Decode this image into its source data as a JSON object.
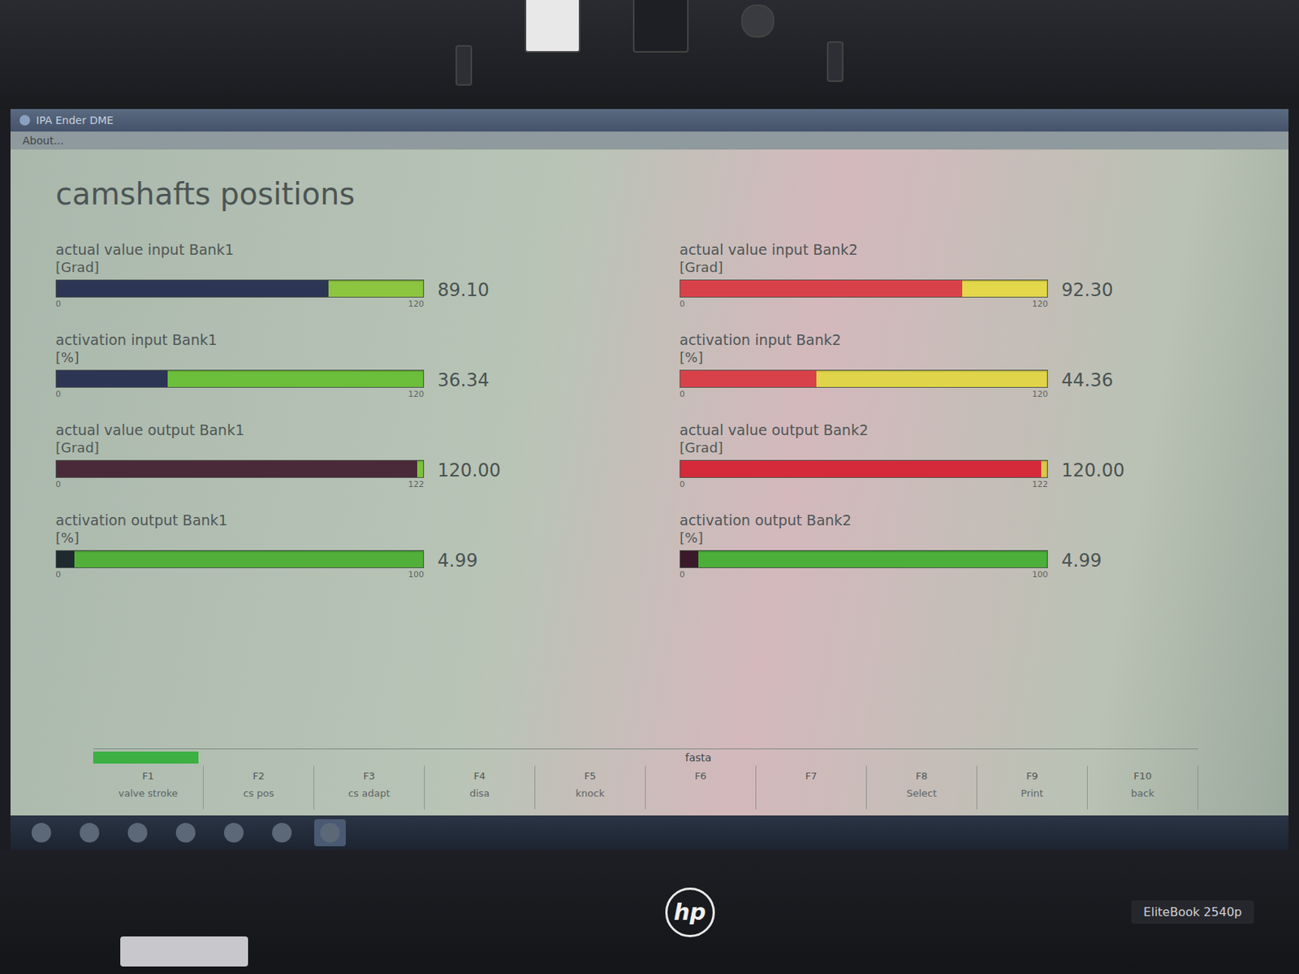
{
  "window": {
    "title": "IPA Ender DME",
    "menu": [
      "About..."
    ]
  },
  "heading": "camshafts positions",
  "columns": [
    {
      "gauges": [
        {
          "label": "actual value input Bank1",
          "unit": "[Grad]",
          "min": "0",
          "max": "120",
          "reading": "89.10",
          "level": 0.7425,
          "color": "#2c3554",
          "track_color": "#8cc640"
        },
        {
          "label": "activation input Bank1",
          "unit": "[%]",
          "min": "0",
          "max": "120",
          "reading": "36.34",
          "level": 0.303,
          "color": "#2c3554",
          "track_color": "#6cbf3a"
        },
        {
          "label": "actual value output Bank1",
          "unit": "[Grad]",
          "min": "0",
          "max": "122",
          "reading": "120.00",
          "level": 0.984,
          "color": "#4a2a38",
          "track_color": "#7cc43e"
        },
        {
          "label": "activation output Bank1",
          "unit": "[%]",
          "min": "0",
          "max": "100",
          "reading": "4.99",
          "level": 0.05,
          "color": "#1e2a30",
          "track_color": "#52b03a"
        }
      ]
    },
    {
      "gauges": [
        {
          "label": "actual value input Bank2",
          "unit": "[Grad]",
          "min": "0",
          "max": "120",
          "reading": "92.30",
          "level": 0.769,
          "color": "#d9414a",
          "track_color": "#e3d84a"
        },
        {
          "label": "activation input Bank2",
          "unit": "[%]",
          "min": "0",
          "max": "120",
          "reading": "44.36",
          "level": 0.37,
          "color": "#d9414a",
          "track_color": "#e0d54a"
        },
        {
          "label": "actual value output Bank2",
          "unit": "[Grad]",
          "min": "0",
          "max": "122",
          "reading": "120.00",
          "level": 0.984,
          "color": "#d42a3a",
          "track_color": "#d8c84a"
        },
        {
          "label": "activation output Bank2",
          "unit": "[%]",
          "min": "0",
          "max": "100",
          "reading": "4.99",
          "level": 0.05,
          "color": "#3a1a2a",
          "track_color": "#4caf3a"
        }
      ]
    }
  ],
  "status": {
    "label": "fasta",
    "indicator_on": true
  },
  "function_keys": [
    {
      "key": "F1",
      "label": "valve stroke"
    },
    {
      "key": "F2",
      "label": "cs pos"
    },
    {
      "key": "F3",
      "label": "cs adapt"
    },
    {
      "key": "F4",
      "label": "disa"
    },
    {
      "key": "F5",
      "label": "knock"
    },
    {
      "key": "F6",
      "label": ""
    },
    {
      "key": "F7",
      "label": ""
    },
    {
      "key": "F8",
      "label": "Select"
    },
    {
      "key": "F9",
      "label": "Print"
    },
    {
      "key": "F10",
      "label": "back"
    }
  ],
  "taskbar": {
    "items": [
      {
        "selected": false
      },
      {
        "selected": false
      },
      {
        "selected": false
      },
      {
        "selected": false
      },
      {
        "selected": false
      },
      {
        "selected": false
      },
      {
        "selected": true
      }
    ]
  },
  "laptop": {
    "brand": "hp",
    "model": "EliteBook 2540p"
  }
}
